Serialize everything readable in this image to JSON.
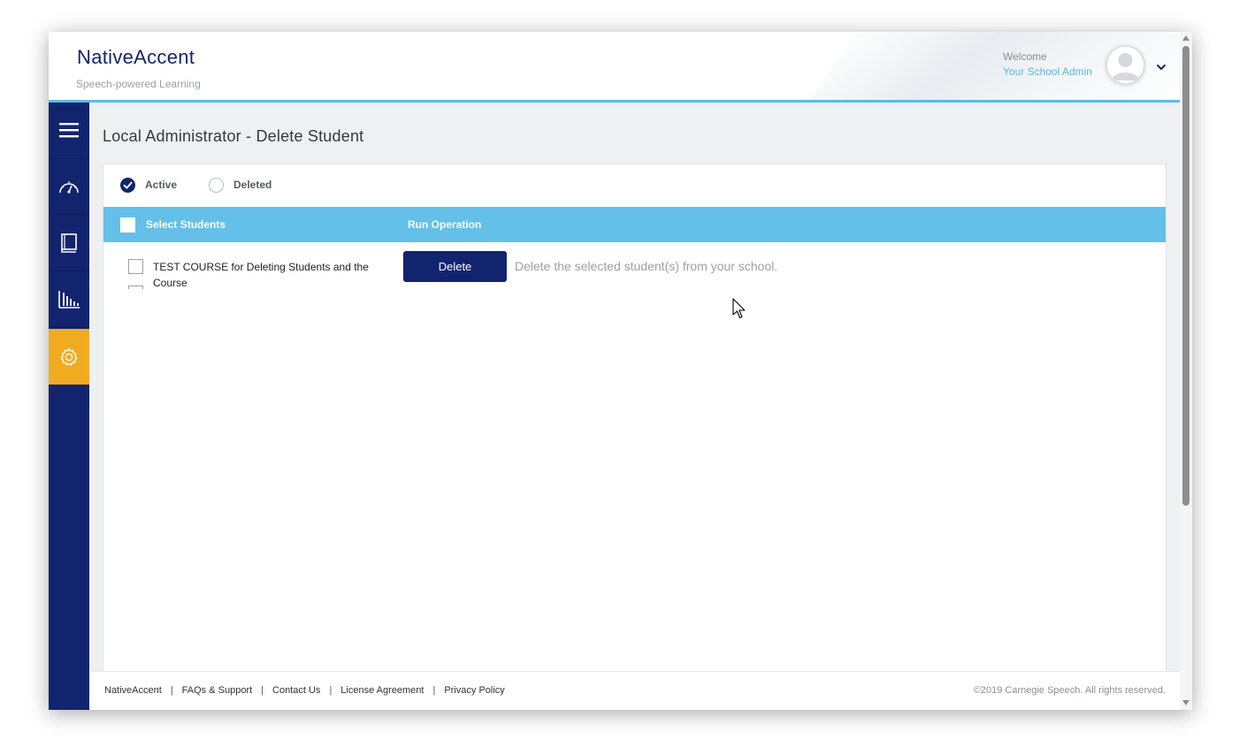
{
  "header": {
    "brand": "NativeAccent",
    "tagline": "Speech-powered Learning",
    "welcome": "Welcome",
    "username": "Your School Admin"
  },
  "sidebar": {
    "items": [
      {
        "icon": "menu-icon"
      },
      {
        "icon": "dashboard-icon"
      },
      {
        "icon": "book-icon"
      },
      {
        "icon": "bar-chart-icon"
      },
      {
        "icon": "gear-icon",
        "active": true
      }
    ]
  },
  "main": {
    "title": "Local Administrator - Delete Student",
    "filters": {
      "active_label": "Active",
      "deleted_label": "Deleted",
      "selected": "Active"
    },
    "table": {
      "col_select": "Select Students",
      "col_operation": "Run Operation",
      "rows": [
        {
          "text": "TEST COURSE for Deleting Students and the Course"
        }
      ]
    },
    "operation": {
      "button_label": "Delete",
      "description": "Delete the selected student(s) from your school."
    }
  },
  "footer": {
    "links": [
      "NativeAccent",
      "FAQs & Support",
      "Contact Us",
      "License Agreement",
      "Privacy Policy"
    ],
    "copyright": "©2019 Carnegie Speech. All rights reserved."
  },
  "colors": {
    "navy": "#13246e",
    "accent_blue": "#64c0e8",
    "active_orange": "#f1ab20"
  }
}
